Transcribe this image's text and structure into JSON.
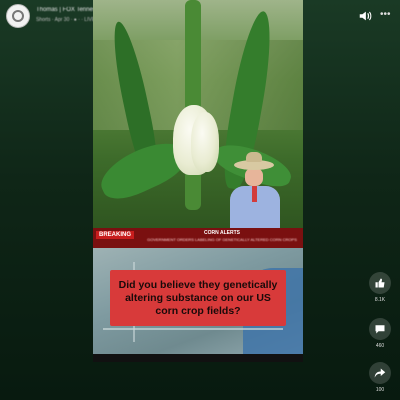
{
  "header": {
    "title": "Thomas | FOX Tennessee | Weather | Video",
    "meta": "Shorts · Apr 30 · ●  ·  ·  LIVE",
    "volume_icon": "volume-icon",
    "more_icon": "more-icon",
    "more_label": "•••"
  },
  "video": {
    "banner": {
      "tag": "BREAKING",
      "headline": "CORN ALERTS",
      "subline": "GOVERNMENT ORDERS LABELING OF GENETICALLY ALTERED CORN CROPS"
    },
    "quote": "Did you believe they genetically altering substance on our US corn crop fields?"
  },
  "actions": [
    {
      "icon": "like-icon",
      "count": "8.1K"
    },
    {
      "icon": "comment-icon",
      "count": "460"
    },
    {
      "icon": "share-icon",
      "count": "100"
    }
  ],
  "colors": {
    "background": "#0f2617",
    "banner": "#7a1010",
    "quote_box": "#d83a3a"
  }
}
